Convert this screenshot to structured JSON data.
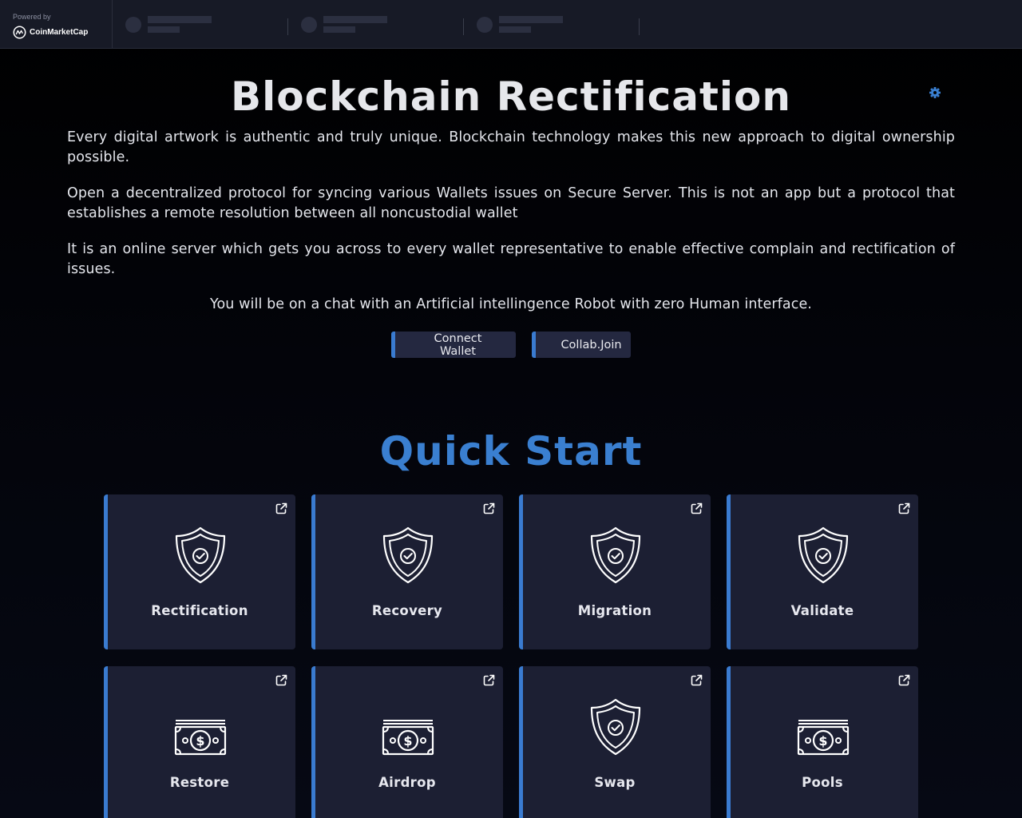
{
  "ticker": {
    "powered_by": "Powered by",
    "brand_name": "CoinMarketCap"
  },
  "hero": {
    "title": "Blockchain Rectification",
    "paragraphs": [
      "Every digital artwork is authentic and truly unique. Blockchain technology makes this new approach to digital ownership possible.",
      "Open a decentralized protocol for syncing various Wallets issues on Secure Server. This is not an app but a protocol that establishes a remote resolution between all noncustodial wallet",
      "It is an online server which gets you across to every wallet representative to enable effective complain and rectification of issues.",
      "You will be on a chat with an Artificial intellingence Robot with zero Human interface."
    ],
    "buttons": {
      "connect": "Connect Wallet",
      "collab": "Collab.Join"
    }
  },
  "quick_start": {
    "title": "Quick Start",
    "cards": [
      {
        "label": "Rectification",
        "icon": "shield-check-icon"
      },
      {
        "label": "Recovery",
        "icon": "shield-check-icon"
      },
      {
        "label": "Migration",
        "icon": "shield-check-icon"
      },
      {
        "label": "Validate",
        "icon": "shield-check-icon"
      },
      {
        "label": "Restore",
        "icon": "dollar-bill-icon"
      },
      {
        "label": "Airdrop",
        "icon": "dollar-bill-icon"
      },
      {
        "label": "Swap",
        "icon": "shield-check-icon"
      },
      {
        "label": "Pools",
        "icon": "dollar-bill-icon"
      }
    ]
  },
  "colors": {
    "accent": "#3a7bd0",
    "card_bg": "#1c1f33",
    "ticker_bg": "#171a26",
    "page_bg": "#000000"
  }
}
